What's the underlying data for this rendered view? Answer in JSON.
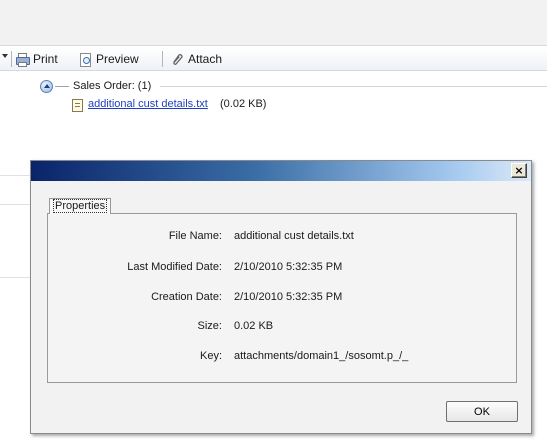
{
  "toolbar": {
    "print_label": "Print",
    "preview_label": "Preview",
    "attach_label": "Attach"
  },
  "attachments": {
    "group_label": "Sales Order: (1)",
    "file": {
      "name": "additional cust details.txt",
      "size": "(0.02 KB)"
    }
  },
  "dialog": {
    "close_symbol": "×",
    "tab_label": "Properties",
    "fields": [
      {
        "label": "File Name:",
        "value": "additional cust details.txt"
      },
      {
        "label": "Last Modified Date:",
        "value": "2/10/2010 5:32:35 PM"
      },
      {
        "label": "Creation Date:",
        "value": "2/10/2010 5:32:35 PM"
      },
      {
        "label": "Size:",
        "value": "0.02 KB"
      },
      {
        "label": "Key:",
        "value": "attachments/domain1_/sosomt.p_/_"
      }
    ],
    "ok_label": "OK"
  },
  "colors": {
    "titlebar_start": "#0a246a",
    "titlebar_end": "#dce9f7",
    "link": "#1f3fbf"
  }
}
